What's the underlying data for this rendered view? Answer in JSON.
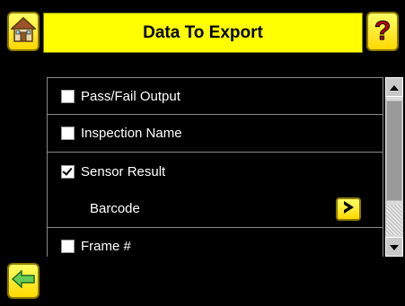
{
  "header": {
    "title": "Data To Export",
    "home_icon": "home-icon",
    "help_icon": "help-icon",
    "help_glyph": "?"
  },
  "list": {
    "items": [
      {
        "label": "Pass/Fail Output",
        "checked": false
      },
      {
        "label": "Inspection Name",
        "checked": false
      },
      {
        "label": "Sensor Result",
        "checked": true
      },
      {
        "label": "Barcode",
        "sub": true
      },
      {
        "label": "Frame #",
        "checked": false
      }
    ]
  },
  "footer": {
    "back_icon": "back-arrow-icon"
  },
  "colors": {
    "accent": "#ffff00",
    "background": "#000000",
    "text": "#ffffff"
  }
}
